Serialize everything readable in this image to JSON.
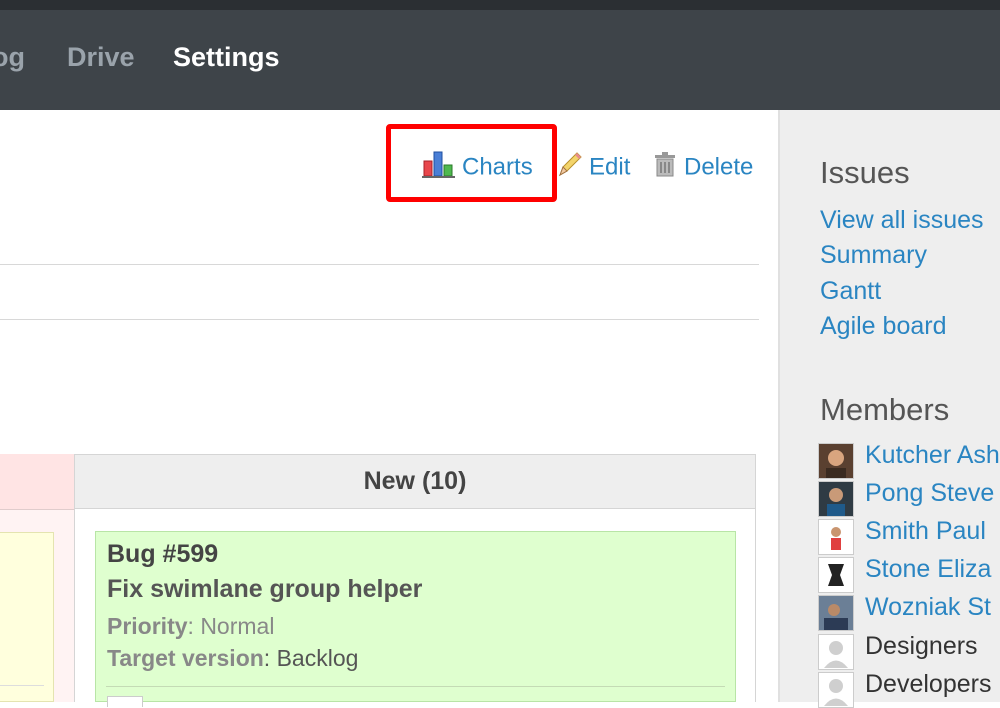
{
  "nav": {
    "blog": "og",
    "drive": "Drive",
    "settings": "Settings"
  },
  "contextual": {
    "charts": "Charts",
    "edit": "Edit",
    "delete": "Delete"
  },
  "board": {
    "column_header": "New (10)",
    "card": {
      "id": "Bug #599",
      "title": "Fix swimlane group helper",
      "fields": [
        {
          "label": "Priority",
          "sep": ": ",
          "value": "Normal"
        },
        {
          "label": "Target version",
          "sep": ": ",
          "value": "Backlog"
        }
      ]
    }
  },
  "sidebar": {
    "issues_title": "Issues",
    "links": [
      "View all issues",
      "Summary",
      "Gantt",
      "Agile board"
    ],
    "members_title": "Members",
    "members": [
      "Kutcher Ash",
      "Pong Steve",
      "Smith Paul",
      "Stone Eliza",
      "Wozniak St",
      "Designers",
      "Developers"
    ]
  },
  "colors": {
    "link": "#2a85c2",
    "header_bg": "#3e4449",
    "highlight": "#ff0000",
    "card_bg": "#dfffcf"
  }
}
